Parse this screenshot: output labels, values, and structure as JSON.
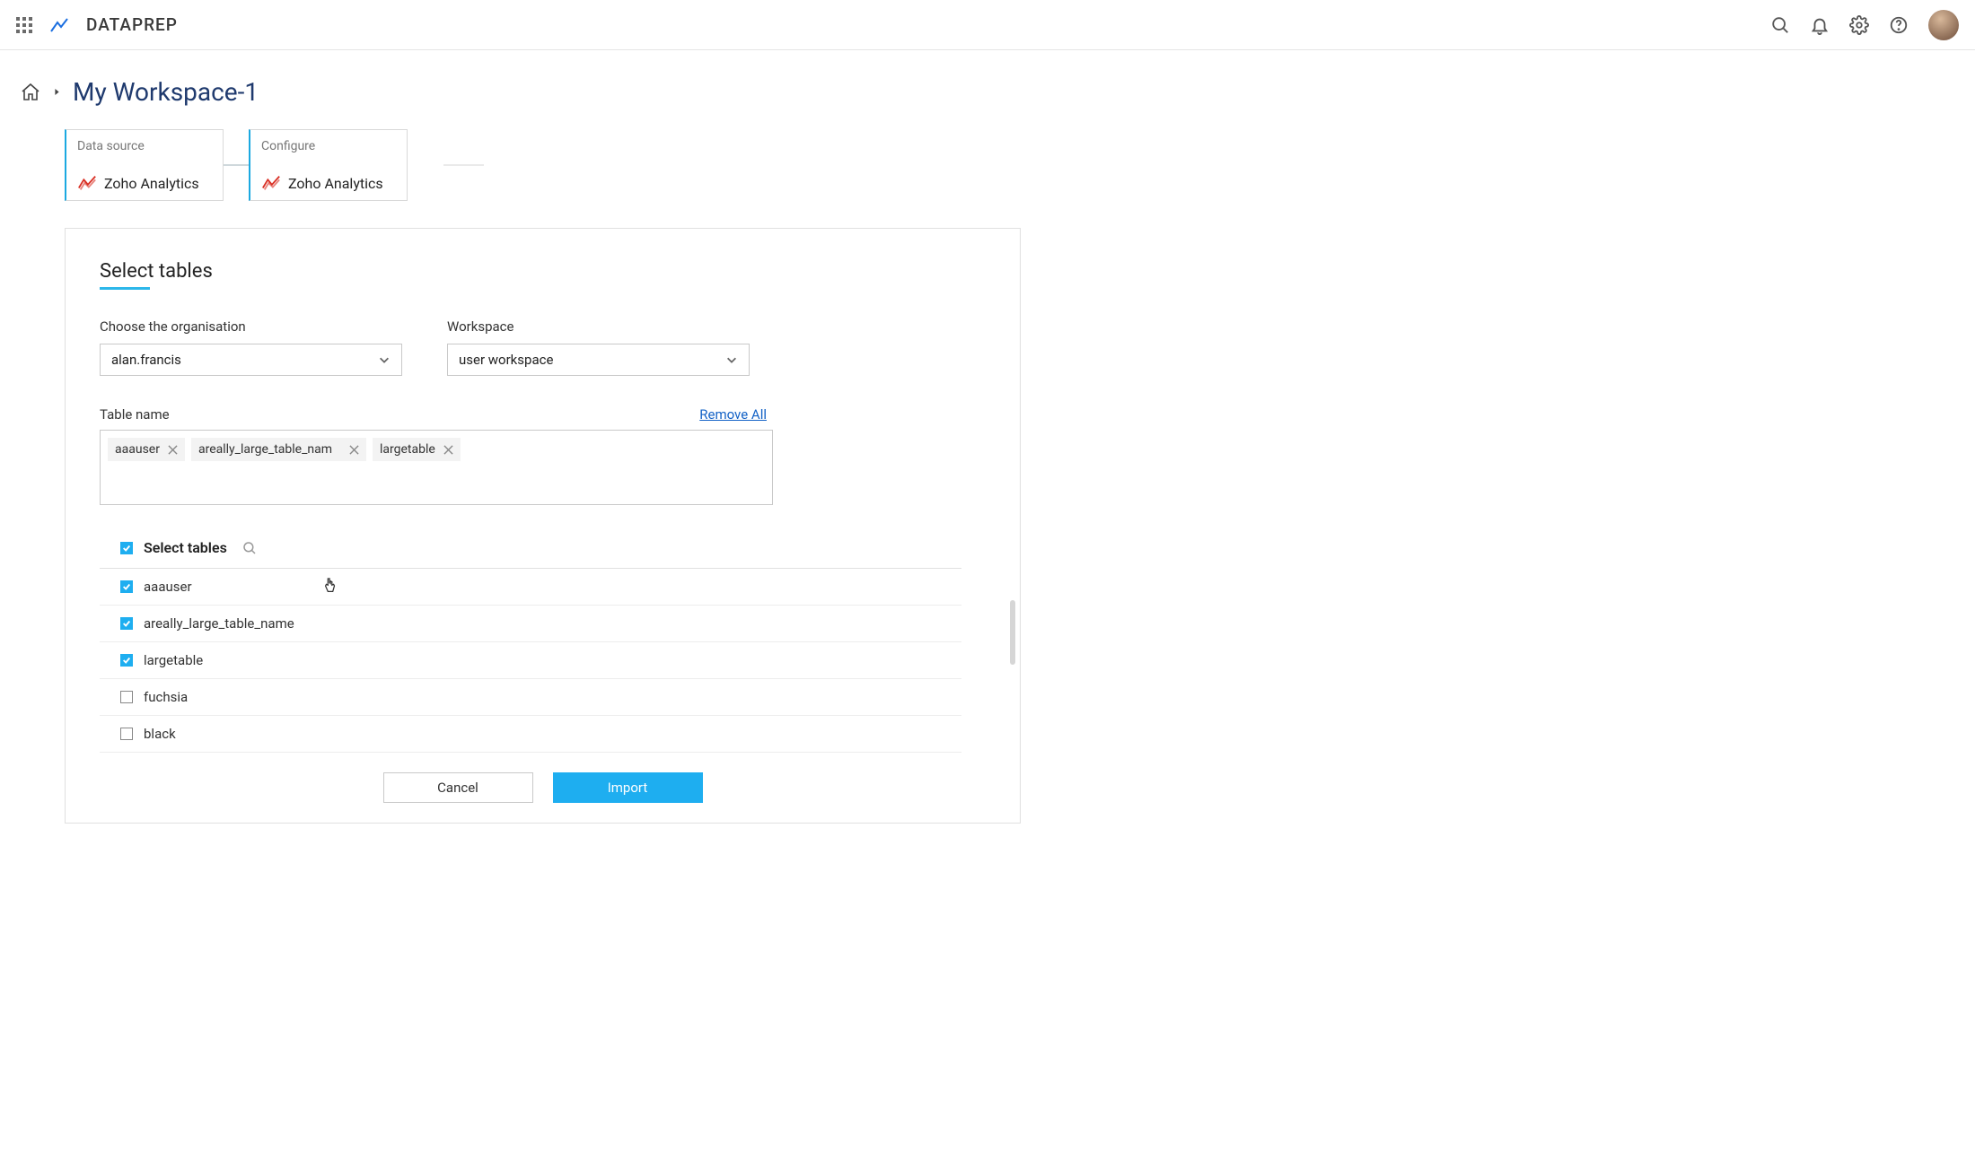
{
  "header": {
    "logo_text": "DATAPREP"
  },
  "breadcrumb": {
    "title": "My Workspace-1"
  },
  "steps": [
    {
      "label": "Data source",
      "value": "Zoho Analytics"
    },
    {
      "label": "Configure",
      "value": "Zoho Analytics"
    }
  ],
  "panel": {
    "title": "Select tables",
    "org_label": "Choose the organisation",
    "org_value": "alan.francis",
    "workspace_label": "Workspace",
    "workspace_value": "user workspace",
    "table_name_label": "Table name",
    "remove_all": "Remove All",
    "tags": [
      "aaauser",
      "areally_large_table_nam",
      "largetable"
    ],
    "select_tables_header": "Select tables",
    "tables": [
      {
        "name": "aaauser",
        "checked": true
      },
      {
        "name": "areally_large_table_name",
        "checked": true
      },
      {
        "name": "largetable",
        "checked": true
      },
      {
        "name": "fuchsia",
        "checked": false
      },
      {
        "name": "black",
        "checked": false
      }
    ],
    "select_all_checked": true,
    "cancel_label": "Cancel",
    "import_label": "Import"
  }
}
